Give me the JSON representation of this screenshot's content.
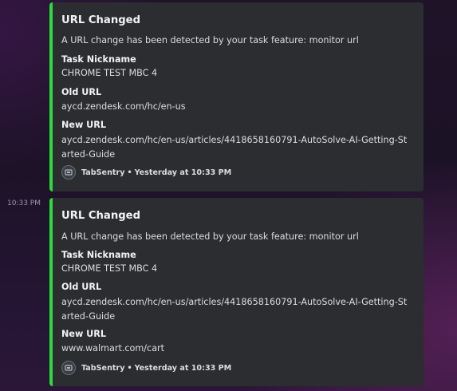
{
  "messages": [
    {
      "timestamp": "",
      "embed": {
        "title": "URL Changed",
        "description": "A URL change has been detected by your task feature: monitor url",
        "fields": [
          {
            "name": "Task Nickname",
            "value": "CHROME TEST MBC 4"
          },
          {
            "name": "Old URL",
            "value": "aycd.zendesk.com/hc/en-us"
          },
          {
            "name": "New URL",
            "value": "aycd.zendesk.com/hc/en-us/articles/4418658160791-AutoSolve-AI-Getting-Started-Guide"
          }
        ],
        "footer": {
          "author": "TabSentry",
          "separator": "•",
          "time": "Yesterday at 10:33 PM"
        },
        "accent_color": "#2cdc3d"
      }
    },
    {
      "timestamp": "10:33 PM",
      "embed": {
        "title": "URL Changed",
        "description": "A URL change has been detected by your task feature: monitor url",
        "fields": [
          {
            "name": "Task Nickname",
            "value": "CHROME TEST MBC 4"
          },
          {
            "name": "Old URL",
            "value": "aycd.zendesk.com/hc/en-us/articles/4418658160791-AutoSolve-AI-Getting-Started-Guide"
          },
          {
            "name": "New URL",
            "value": "www.walmart.com/cart"
          }
        ],
        "footer": {
          "author": "TabSentry",
          "separator": "•",
          "time": "Yesterday at 10:33 PM"
        },
        "accent_color": "#2cdc3d"
      }
    }
  ],
  "icons": {
    "footer_avatar": "tabsentry-logo-icon"
  }
}
